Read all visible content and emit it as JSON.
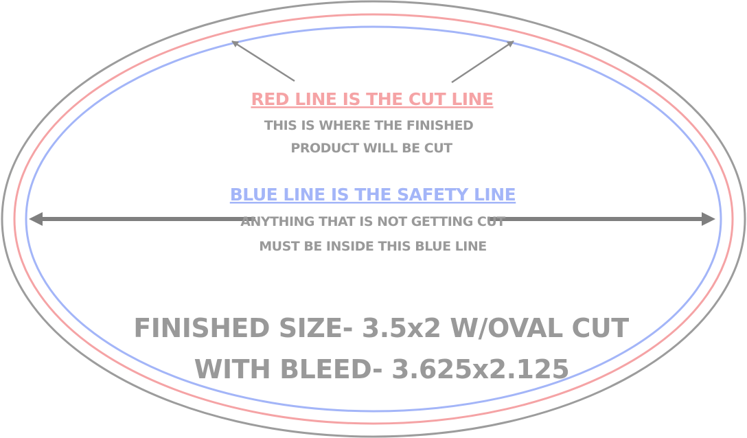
{
  "colors": {
    "bleed_line": "#9c9c9c",
    "cut_line": "#f5a3a5",
    "safety_line": "#a3b5f8",
    "text_gray": "#999999",
    "arrow_gray": "#8c8c8c",
    "arrow_dark": "#7f7f7f"
  },
  "red_heading": "RED LINE IS THE CUT LINE",
  "red_desc_1": "THIS IS WHERE THE FINISHED",
  "red_desc_2": "PRODUCT WILL BE CUT",
  "blue_heading": "BLUE LINE IS THE SAFETY LINE",
  "blue_desc_1": "ANYTHING THAT IS NOT GETTING CUT",
  "blue_desc_2": "MUST BE INSIDE THIS BLUE LINE",
  "size_line_1": "FINISHED SIZE- 3.5x2 W/OVAL CUT",
  "size_line_2": "WITH BLEED- 3.625x2.125"
}
